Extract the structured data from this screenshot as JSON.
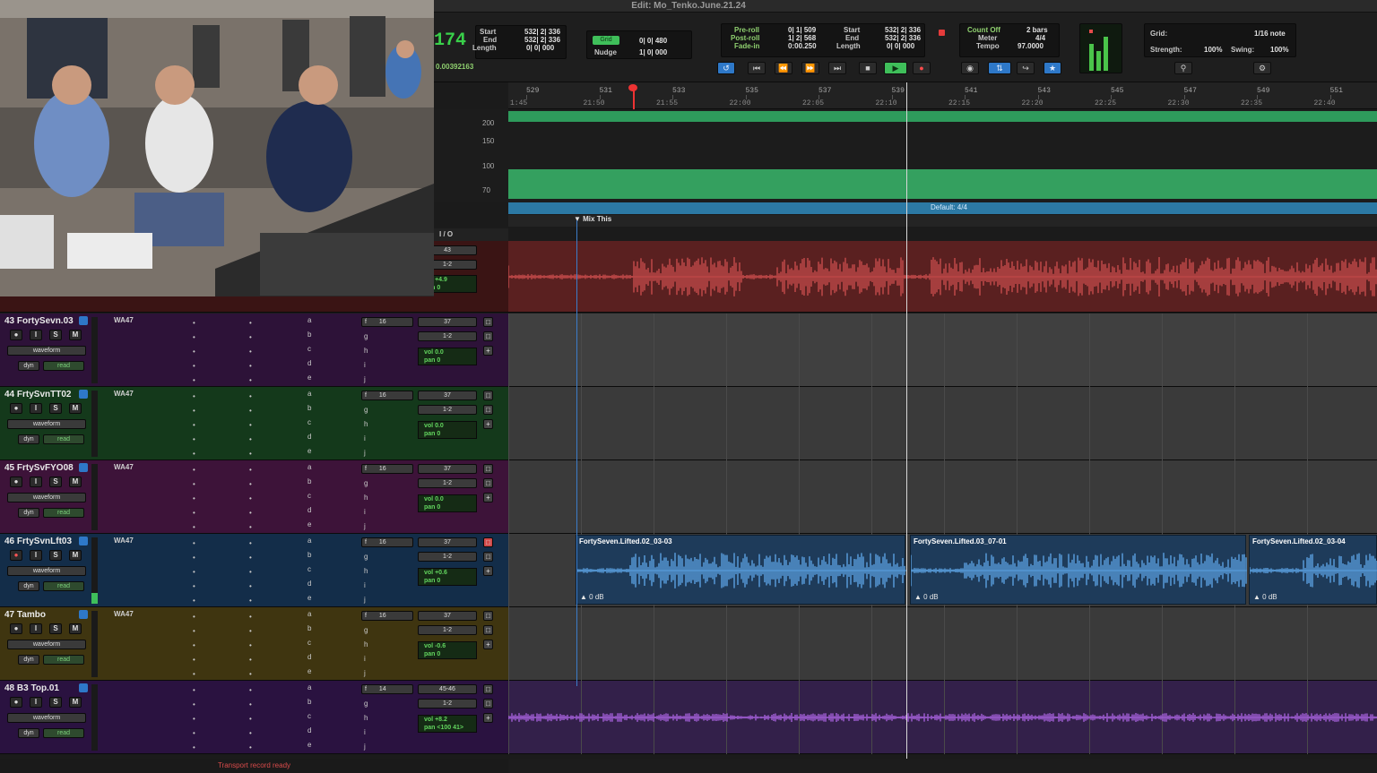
{
  "window": {
    "title": "Edit: Mo_Tenko.June.21.24"
  },
  "counter": {
    "main": "174",
    "sub": "0.00392163"
  },
  "selection": {
    "start_label": "Start",
    "end_label": "End",
    "length_label": "Length",
    "start": "532| 2| 336",
    "end": "532| 2| 336",
    "length": "0| 0| 000"
  },
  "grid_nudge": {
    "grid_label": "Grid",
    "grid_value": "0| 0| 480",
    "nudge_label": "Nudge",
    "nudge_value": "1| 0| 000"
  },
  "prepost": {
    "preroll_label": "Pre-roll",
    "postroll_label": "Post-roll",
    "fadein_label": "Fade-in",
    "preroll": "0| 1| 509",
    "postroll": "1| 2| 568",
    "fadein": "0:00.250"
  },
  "timeline_sel": {
    "start_label": "Start",
    "end_label": "End",
    "length_label": "Length",
    "start": "532| 2| 336",
    "end": "532| 2| 336",
    "length": "0| 0| 000"
  },
  "countoff": {
    "count_label": "Count Off",
    "meter_label": "Meter",
    "tempo_label": "Tempo",
    "count_value": "2 bars",
    "meter_value": "4/4",
    "tempo_value": "97.0000"
  },
  "grid_panel": {
    "grid_label": "Grid:",
    "grid_value": "1/16 note",
    "strength_label": "Strength:",
    "strength_value": "100%",
    "swing_label": "Swing:",
    "swing_value": "100%"
  },
  "ruler": {
    "bars": [
      "529",
      "531",
      "533",
      "535",
      "537",
      "539",
      "541",
      "543",
      "545",
      "547",
      "549",
      "551"
    ],
    "timecodes": [
      "1:45",
      "21:50",
      "21:55",
      "22:00",
      "22:05",
      "22:10",
      "22:15",
      "22:20",
      "22:25",
      "22:30",
      "22:35",
      "22:40"
    ]
  },
  "tempo_scale": [
    "200",
    "150",
    "100",
    "70"
  ],
  "meter": {
    "text": "Default: 4/4"
  },
  "marker": {
    "text": "Mix This"
  },
  "io_header": "I / O",
  "status": {
    "text": "Transport record ready"
  },
  "tracks": [
    {
      "name": "43 FortySevn.03",
      "insert": "WA47",
      "view": "waveform",
      "dyn": "dyn",
      "auto": "read",
      "send": "16",
      "input": "37",
      "output": "1-2",
      "vol": "0.0",
      "pan": "0"
    },
    {
      "name": "44 FrtySvnTT02",
      "insert": "WA47",
      "view": "waveform",
      "dyn": "dyn",
      "auto": "read",
      "send": "16",
      "input": "37",
      "output": "1-2",
      "vol": "0.0",
      "pan": "0"
    },
    {
      "name": "45 FrtySvFYO08",
      "insert": "WA47",
      "view": "waveform",
      "dyn": "dyn",
      "auto": "read",
      "send": "16",
      "input": "37",
      "output": "1-2",
      "vol": "0.0",
      "pan": "0"
    },
    {
      "name": "46 FrtySvnLft03",
      "insert": "WA47",
      "view": "waveform",
      "dyn": "dyn",
      "auto": "read",
      "send": "16",
      "input": "37",
      "output": "1-2",
      "vol": "+0.6",
      "pan": "0"
    },
    {
      "name": "47 Tambo",
      "insert": "WA47",
      "view": "waveform",
      "dyn": "dyn",
      "auto": "read",
      "send": "16",
      "input": "37",
      "output": "1-2",
      "vol": "-0.6",
      "pan": "0"
    },
    {
      "name": "48 B3 Top.01",
      "insert": "",
      "view": "waveform",
      "dyn": "dyn",
      "auto": "read",
      "send": "14",
      "input": "45-46",
      "output": "1-2",
      "vol": "+8.2",
      "pan": "<100  41>"
    }
  ],
  "top_track": {
    "input": "43",
    "output": "1-2",
    "vol": "+4.9",
    "pan": "0"
  },
  "insert_letters": [
    "a",
    "b",
    "c",
    "d",
    "e"
  ],
  "send_letters": [
    "f",
    "g",
    "h",
    "i",
    "j"
  ],
  "clips": [
    {
      "name": "FortySeven.Lifted.02_03-03",
      "gain": "0 dB"
    },
    {
      "name": "FortySeven.Lifted.03_07-01",
      "gain": "0 dB"
    },
    {
      "name": "FortySeven.Lifted.02_03-04",
      "gain": "0 dB"
    }
  ],
  "colors": {
    "track43": "#2d1238",
    "track44": "#14391b",
    "track45": "#3d1339",
    "track46": "#132d49",
    "track47": "#3f3510",
    "track48": "#2a1240",
    "top_audio": "#c64b4b",
    "blue_audio": "#5aa0e0",
    "purple_audio": "#a35fd8"
  }
}
